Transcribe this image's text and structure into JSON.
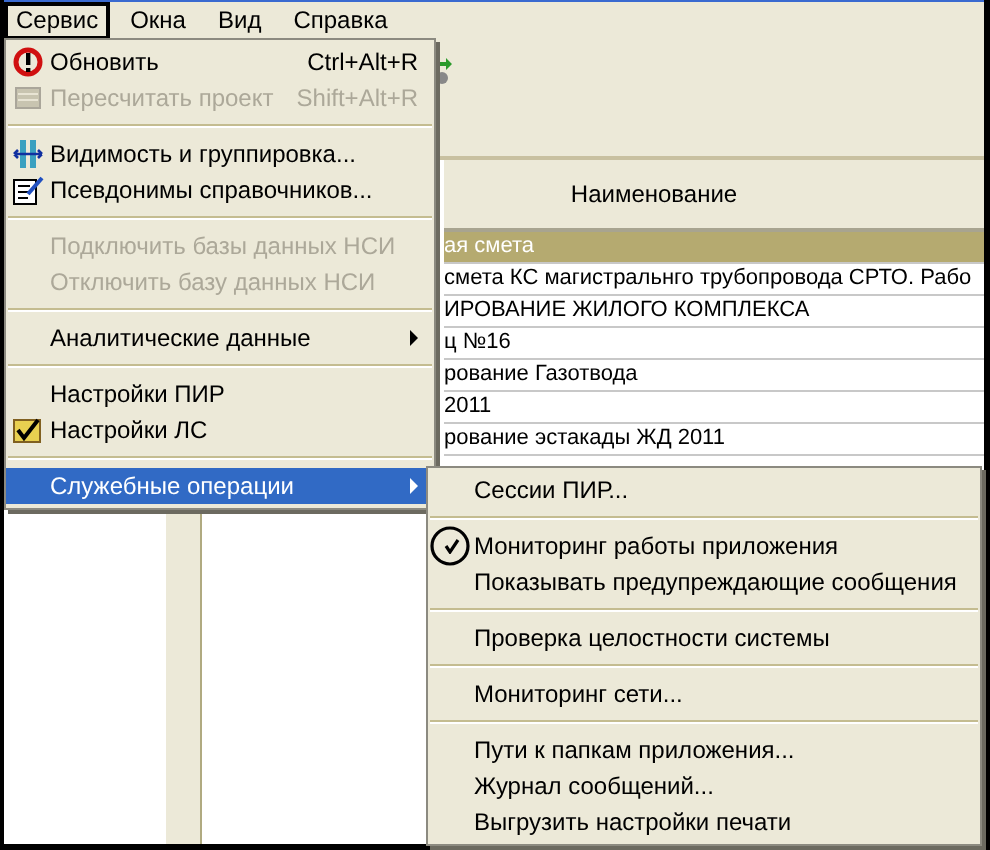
{
  "menu_bar": [
    {
      "label": "Сервис",
      "selected": true
    },
    {
      "label": "Окна",
      "selected": false
    },
    {
      "label": "Вид",
      "selected": false
    },
    {
      "label": "Справка",
      "selected": false
    }
  ],
  "grid": {
    "columns": [
      "Наименование"
    ],
    "rows": [
      {
        "name": "ая смета",
        "selected": true
      },
      {
        "name": "смета КС  магистральнго трубопровода СРТО. Рабо",
        "selected": false
      },
      {
        "name": "ИРОВАНИЕ ЖИЛОГО КОМПЛЕКСА",
        "selected": false
      },
      {
        "name": "ц №16",
        "selected": false
      },
      {
        "name": "рование Газотвода",
        "selected": false
      },
      {
        "name": "2011",
        "selected": false
      },
      {
        "name": "рование эстакады ЖД 2011",
        "selected": false
      }
    ]
  },
  "menu": [
    {
      "kind": "item",
      "label": "Обновить",
      "shortcut": "Ctrl+Alt+R",
      "disabled": false,
      "checked": false,
      "submenu": false,
      "selected": false
    },
    {
      "kind": "item",
      "label": "Пересчитать проект",
      "shortcut": "Shift+Alt+R",
      "disabled": true,
      "checked": false,
      "submenu": false,
      "selected": false
    },
    {
      "kind": "separator"
    },
    {
      "kind": "item",
      "label": "Видимость и группировка...",
      "disabled": false,
      "checked": false,
      "submenu": false,
      "selected": false
    },
    {
      "kind": "item",
      "label": "Псевдонимы справочников...",
      "disabled": false,
      "checked": false,
      "submenu": false,
      "selected": false
    },
    {
      "kind": "separator"
    },
    {
      "kind": "item",
      "label": "Подключить базы данных НСИ",
      "disabled": true,
      "checked": false,
      "submenu": false,
      "selected": false
    },
    {
      "kind": "item",
      "label": "Отключить базу данных НСИ",
      "disabled": true,
      "checked": false,
      "submenu": false,
      "selected": false
    },
    {
      "kind": "separator"
    },
    {
      "kind": "item",
      "label": "Аналитические данные",
      "disabled": false,
      "checked": false,
      "submenu": true,
      "selected": false
    },
    {
      "kind": "separator"
    },
    {
      "kind": "item",
      "label": "Настройки ПИР",
      "disabled": false,
      "checked": false,
      "submenu": false,
      "selected": false
    },
    {
      "kind": "item",
      "label": "Настройки ЛС",
      "disabled": false,
      "checked": true,
      "submenu": false,
      "selected": false
    },
    {
      "kind": "separator"
    },
    {
      "kind": "item",
      "label": "Служебные операции",
      "disabled": false,
      "checked": false,
      "submenu": true,
      "selected": true
    }
  ],
  "submenu": [
    {
      "kind": "item",
      "label": "Сессии ПИР...",
      "checked": false,
      "circled": false
    },
    {
      "kind": "separator"
    },
    {
      "kind": "item",
      "label": "Мониторинг работы приложения",
      "checked": true,
      "circled": true
    },
    {
      "kind": "item",
      "label": "Показывать предупреждающие сообщения",
      "checked": false,
      "circled": false
    },
    {
      "kind": "separator"
    },
    {
      "kind": "item",
      "label": "Проверка целостности системы",
      "checked": false,
      "circled": false
    },
    {
      "kind": "separator"
    },
    {
      "kind": "item",
      "label": "Мониторинг сети...",
      "checked": false,
      "circled": false
    },
    {
      "kind": "separator"
    },
    {
      "kind": "item",
      "label": "Пути к папкам приложения...",
      "checked": false,
      "circled": false
    },
    {
      "kind": "item",
      "label": "Журнал сообщений...",
      "checked": false,
      "circled": false
    },
    {
      "kind": "item",
      "label": "Выгрузить настройки печати",
      "checked": false,
      "circled": false
    }
  ]
}
